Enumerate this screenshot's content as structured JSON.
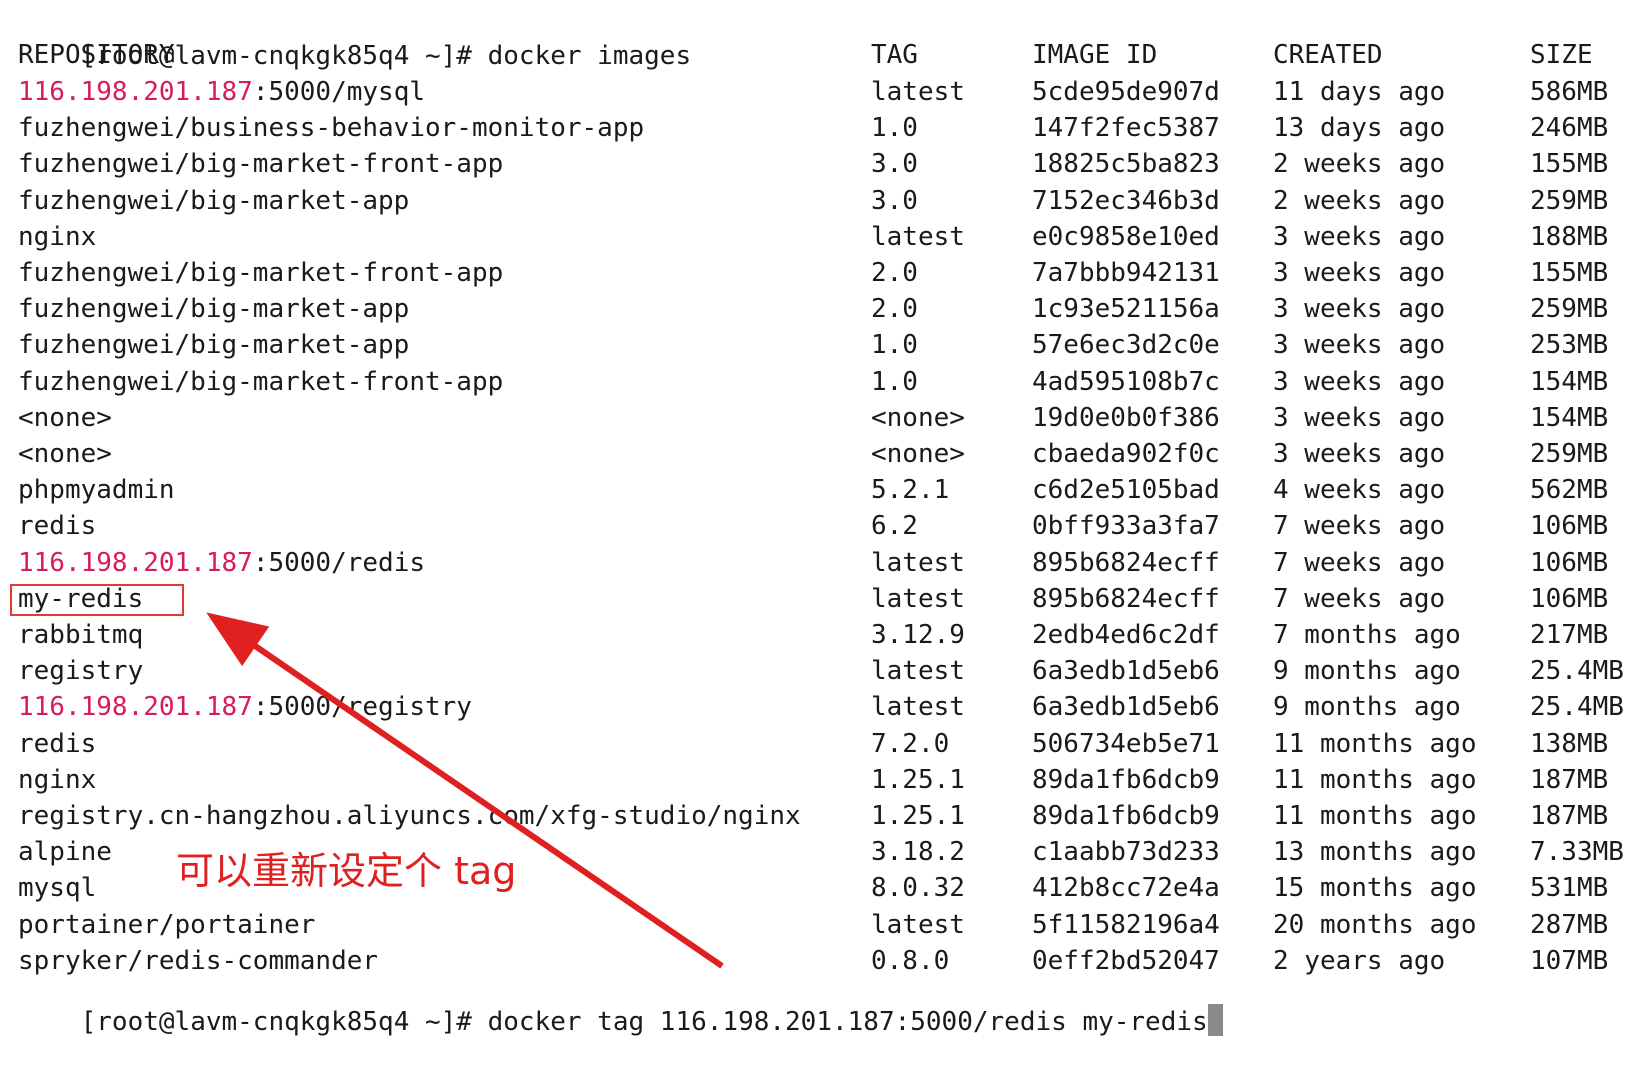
{
  "prompt_top": "[root@lavm-cnqkgk85q4 ~]# docker images",
  "headers": {
    "repository": "REPOSITORY",
    "tag": "TAG",
    "image_id": "IMAGE ID",
    "created": "CREATED",
    "size": "SIZE"
  },
  "rows": [
    {
      "repo_ip": "116.198.201.187",
      "repo_rest": ":5000/mysql",
      "tag": "latest",
      "image_id": "5cde95de907d",
      "created": "11 days ago",
      "size": "586MB"
    },
    {
      "repo_ip": "",
      "repo_rest": "fuzhengwei/business-behavior-monitor-app",
      "tag": "1.0",
      "image_id": "147f2fec5387",
      "created": "13 days ago",
      "size": "246MB"
    },
    {
      "repo_ip": "",
      "repo_rest": "fuzhengwei/big-market-front-app",
      "tag": "3.0",
      "image_id": "18825c5ba823",
      "created": "2 weeks ago",
      "size": "155MB"
    },
    {
      "repo_ip": "",
      "repo_rest": "fuzhengwei/big-market-app",
      "tag": "3.0",
      "image_id": "7152ec346b3d",
      "created": "2 weeks ago",
      "size": "259MB"
    },
    {
      "repo_ip": "",
      "repo_rest": "nginx",
      "tag": "latest",
      "image_id": "e0c9858e10ed",
      "created": "3 weeks ago",
      "size": "188MB"
    },
    {
      "repo_ip": "",
      "repo_rest": "fuzhengwei/big-market-front-app",
      "tag": "2.0",
      "image_id": "7a7bbb942131",
      "created": "3 weeks ago",
      "size": "155MB"
    },
    {
      "repo_ip": "",
      "repo_rest": "fuzhengwei/big-market-app",
      "tag": "2.0",
      "image_id": "1c93e521156a",
      "created": "3 weeks ago",
      "size": "259MB"
    },
    {
      "repo_ip": "",
      "repo_rest": "fuzhengwei/big-market-app",
      "tag": "1.0",
      "image_id": "57e6ec3d2c0e",
      "created": "3 weeks ago",
      "size": "253MB"
    },
    {
      "repo_ip": "",
      "repo_rest": "fuzhengwei/big-market-front-app",
      "tag": "1.0",
      "image_id": "4ad595108b7c",
      "created": "3 weeks ago",
      "size": "154MB"
    },
    {
      "repo_ip": "",
      "repo_rest": "<none>",
      "tag": "<none>",
      "image_id": "19d0e0b0f386",
      "created": "3 weeks ago",
      "size": "154MB"
    },
    {
      "repo_ip": "",
      "repo_rest": "<none>",
      "tag": "<none>",
      "image_id": "cbaeda902f0c",
      "created": "3 weeks ago",
      "size": "259MB"
    },
    {
      "repo_ip": "",
      "repo_rest": "phpmyadmin",
      "tag": "5.2.1",
      "image_id": "c6d2e5105bad",
      "created": "4 weeks ago",
      "size": "562MB"
    },
    {
      "repo_ip": "",
      "repo_rest": "redis",
      "tag": "6.2",
      "image_id": "0bff933a3fa7",
      "created": "7 weeks ago",
      "size": "106MB"
    },
    {
      "repo_ip": "116.198.201.187",
      "repo_rest": ":5000/redis",
      "tag": "latest",
      "image_id": "895b6824ecff",
      "created": "7 weeks ago",
      "size": "106MB"
    },
    {
      "repo_ip": "",
      "repo_rest": "my-redis",
      "tag": "latest",
      "image_id": "895b6824ecff",
      "created": "7 weeks ago",
      "size": "106MB"
    },
    {
      "repo_ip": "",
      "repo_rest": "rabbitmq",
      "tag": "3.12.9",
      "image_id": "2edb4ed6c2df",
      "created": "7 months ago",
      "size": "217MB"
    },
    {
      "repo_ip": "",
      "repo_rest": "registry",
      "tag": "latest",
      "image_id": "6a3edb1d5eb6",
      "created": "9 months ago",
      "size": "25.4MB"
    },
    {
      "repo_ip": "116.198.201.187",
      "repo_rest": ":5000/registry",
      "tag": "latest",
      "image_id": "6a3edb1d5eb6",
      "created": "9 months ago",
      "size": "25.4MB"
    },
    {
      "repo_ip": "",
      "repo_rest": "redis",
      "tag": "7.2.0",
      "image_id": "506734eb5e71",
      "created": "11 months ago",
      "size": "138MB"
    },
    {
      "repo_ip": "",
      "repo_rest": "nginx",
      "tag": "1.25.1",
      "image_id": "89da1fb6dcb9",
      "created": "11 months ago",
      "size": "187MB"
    },
    {
      "repo_ip": "",
      "repo_rest": "registry.cn-hangzhou.aliyuncs.com/xfg-studio/nginx",
      "tag": "1.25.1",
      "image_id": "89da1fb6dcb9",
      "created": "11 months ago",
      "size": "187MB"
    },
    {
      "repo_ip": "",
      "repo_rest": "alpine",
      "tag": "3.18.2",
      "image_id": "c1aabb73d233",
      "created": "13 months ago",
      "size": "7.33MB"
    },
    {
      "repo_ip": "",
      "repo_rest": "mysql",
      "tag": "8.0.32",
      "image_id": "412b8cc72e4a",
      "created": "15 months ago",
      "size": "531MB"
    },
    {
      "repo_ip": "",
      "repo_rest": "portainer/portainer",
      "tag": "latest",
      "image_id": "5f11582196a4",
      "created": "20 months ago",
      "size": "287MB"
    },
    {
      "repo_ip": "",
      "repo_rest": "spryker/redis-commander",
      "tag": "0.8.0",
      "image_id": "0eff2bd52047",
      "created": "2 years ago",
      "size": "107MB"
    }
  ],
  "prompt_bottom": "[root@lavm-cnqkgk85q4 ~]# docker tag 116.198.201.187:5000/redis my-redis",
  "annotation": {
    "text": "可以重新设定个 tag",
    "color": "#e02020"
  },
  "colors": {
    "ip_highlight": "#d81b60",
    "annotation": "#e02020",
    "cursor": "#8a8a8a"
  }
}
